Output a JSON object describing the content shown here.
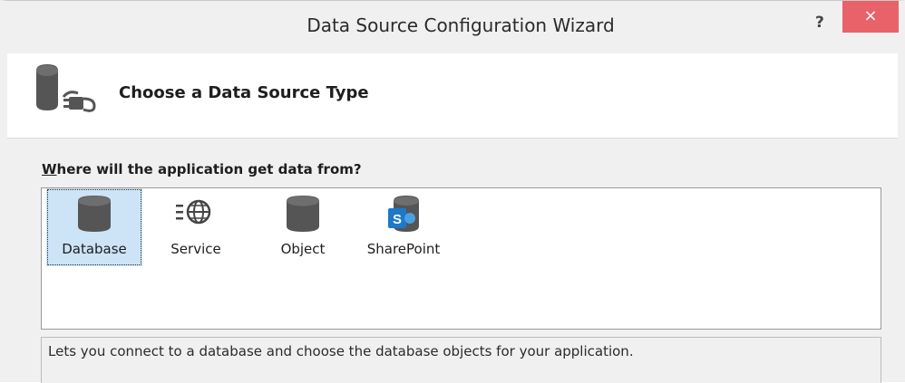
{
  "window": {
    "title": "Data Source Configuration Wizard",
    "help_label": "?",
    "close_label": "×",
    "close_color": "#e8626a"
  },
  "header": {
    "title": "Choose a Data Source Type",
    "icon": "database-plug-icon"
  },
  "prompt": {
    "accesskey": "W",
    "rest": "here will the application get data from?"
  },
  "source_types": [
    {
      "label": "Database",
      "icon": "database-icon",
      "selected": true
    },
    {
      "label": "Service",
      "icon": "service-globe-icon",
      "selected": false
    },
    {
      "label": "Object",
      "icon": "object-cylinder-icon",
      "selected": false
    },
    {
      "label": "SharePoint",
      "icon": "sharepoint-icon",
      "selected": false
    }
  ],
  "description": "Lets you connect to a database and choose the database objects for your application.",
  "colors": {
    "selection": "#cde4f7",
    "icon_gray": "#5a5a5a",
    "sharepoint_blue": "#1d78c9"
  }
}
